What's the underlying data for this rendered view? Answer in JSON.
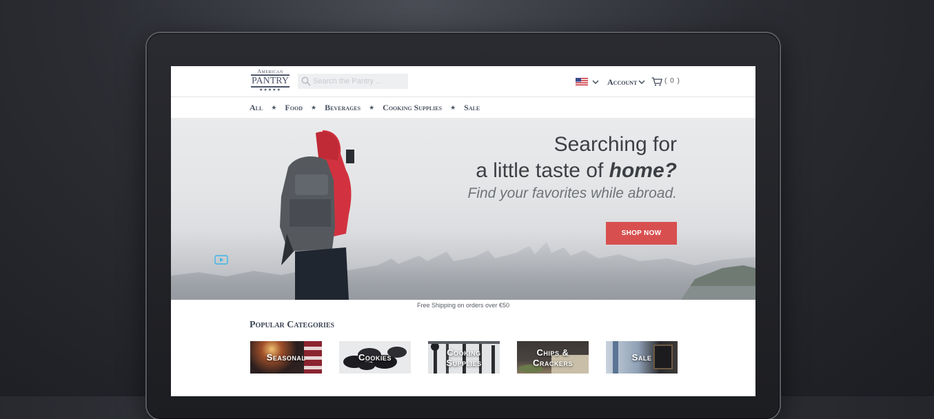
{
  "header": {
    "logo": {
      "top": "American",
      "main": "PANTRY",
      "stars": "★★★★★"
    },
    "search_placeholder": "Search the Pantry ...",
    "account_label": "Account",
    "cart_count": "( 0 )"
  },
  "nav": {
    "items": [
      "All",
      "Food",
      "Beverages",
      "Cooking Supplies",
      "Sale"
    ]
  },
  "hero": {
    "line1": "Searching for",
    "line2_prefix": "a little taste of ",
    "line2_emph": "home?",
    "subtitle": "Find your favorites while abroad.",
    "cta": "SHOP NOW"
  },
  "shipping_note": "Free Shipping on orders over €50",
  "categories": {
    "title": "Popular Categories",
    "items": [
      "Seasonal",
      "Cookies",
      "Cooking Supplies",
      "Chips & Crackers",
      "Sale"
    ]
  },
  "colors": {
    "accent": "#d84f4f",
    "text_dark": "#3d4656"
  },
  "icons": [
    "search-icon",
    "us-flag-icon",
    "chevron-down-icon",
    "cart-icon",
    "play-icon"
  ]
}
